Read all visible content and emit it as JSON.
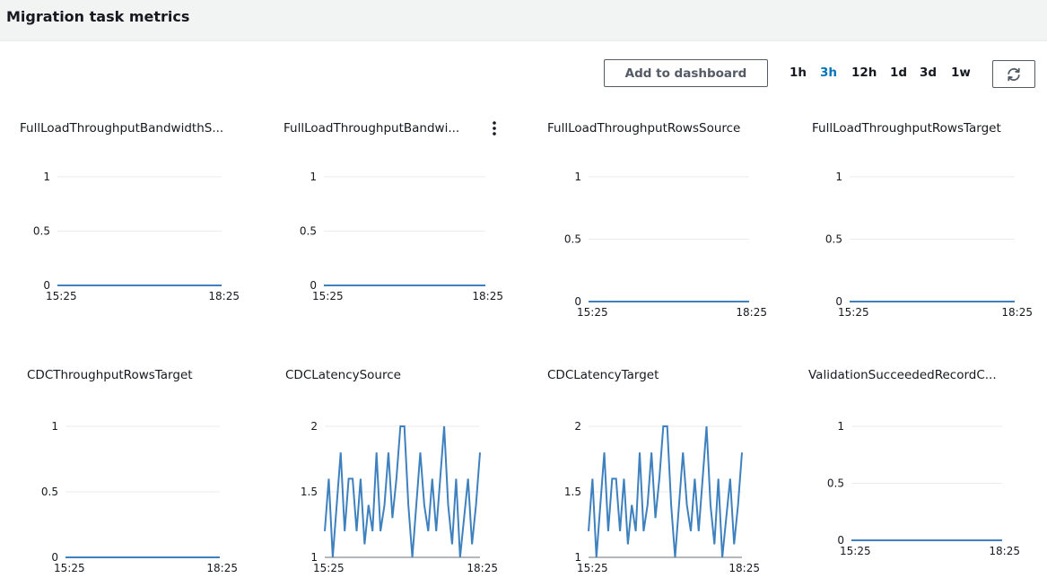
{
  "header": {
    "title": "Migration task metrics"
  },
  "toolbar": {
    "add_to_dashboard_label": "Add to dashboard",
    "time_ranges": [
      "1h",
      "3h",
      "12h",
      "1d",
      "3d",
      "1w"
    ],
    "selected_time_range": "3h",
    "refresh_icon": "refresh-icon",
    "widget_menu_icon": "more-vertical-icon"
  },
  "colors": {
    "line": "#3e81be",
    "selected_range": "#0073bb",
    "gridline": "#e9ebed",
    "axis": "#687078"
  },
  "chart_data": [
    {
      "type": "line",
      "title": "FullLoadThroughputBandwidthS...",
      "x": [
        "15:25",
        "18:25"
      ],
      "yticks": [
        "0",
        "0.5",
        "1"
      ],
      "ylim": [
        0,
        1
      ],
      "series": [
        {
          "values": [
            0,
            0
          ]
        }
      ]
    },
    {
      "type": "line",
      "title": "FullLoadThroughputBandwi...",
      "x": [
        "15:25",
        "18:25"
      ],
      "yticks": [
        "0",
        "0.5",
        "1"
      ],
      "ylim": [
        0,
        1
      ],
      "series": [
        {
          "values": [
            0,
            0
          ]
        }
      ]
    },
    {
      "type": "line",
      "title": "FullLoadThroughputRowsSource",
      "x": [
        "15:25",
        "18:25"
      ],
      "yticks": [
        "0",
        "0.5",
        "1"
      ],
      "ylim": [
        0,
        1
      ],
      "series": [
        {
          "values": [
            0,
            0
          ]
        }
      ]
    },
    {
      "type": "line",
      "title": "FullLoadThroughputRowsTarget",
      "x": [
        "15:25",
        "18:25"
      ],
      "yticks": [
        "0",
        "0.5",
        "1"
      ],
      "ylim": [
        0,
        1
      ],
      "series": [
        {
          "values": [
            0,
            0
          ]
        }
      ]
    },
    {
      "type": "line",
      "title": "CDCThroughputRowsTarget",
      "x": [
        "15:25",
        "18:25"
      ],
      "yticks": [
        "0",
        "0.5",
        "1"
      ],
      "ylim": [
        0,
        1
      ],
      "series": [
        {
          "values": [
            0,
            0
          ]
        }
      ]
    },
    {
      "type": "line",
      "title": "CDCLatencySource",
      "x": [
        "15:25",
        "18:25"
      ],
      "yticks": [
        "1",
        "1.5",
        "2"
      ],
      "ylim": [
        1,
        2
      ],
      "series": [
        {
          "values": [
            1.2,
            1.6,
            1,
            1.4,
            1.8,
            1.2,
            1.6,
            1.6,
            1.2,
            1.6,
            1.1,
            1.4,
            1.2,
            1.8,
            1.2,
            1.4,
            1.8,
            1.3,
            1.6,
            2,
            2,
            1.4,
            1,
            1.4,
            1.8,
            1.4,
            1.2,
            1.6,
            1.2,
            1.6,
            2,
            1.4,
            1.1,
            1.6,
            1,
            1.3,
            1.6,
            1.1,
            1.4,
            1.8
          ]
        }
      ]
    },
    {
      "type": "line",
      "title": "CDCLatencyTarget",
      "x": [
        "15:25",
        "18:25"
      ],
      "yticks": [
        "1",
        "1.5",
        "2"
      ],
      "ylim": [
        1,
        2
      ],
      "series": [
        {
          "values": [
            1.2,
            1.6,
            1,
            1.4,
            1.8,
            1.2,
            1.6,
            1.6,
            1.2,
            1.6,
            1.1,
            1.4,
            1.2,
            1.8,
            1.2,
            1.4,
            1.8,
            1.3,
            1.6,
            2,
            2,
            1.4,
            1,
            1.4,
            1.8,
            1.4,
            1.2,
            1.6,
            1.2,
            1.6,
            2,
            1.4,
            1.1,
            1.6,
            1,
            1.3,
            1.6,
            1.1,
            1.4,
            1.8
          ]
        }
      ]
    },
    {
      "type": "line",
      "title": "ValidationSucceededRecordC...",
      "x": [
        "15:25",
        "18:25"
      ],
      "yticks": [
        "0",
        "0.5",
        "1"
      ],
      "ylim": [
        0,
        1
      ],
      "series": [
        {
          "values": [
            0,
            0
          ]
        }
      ]
    }
  ]
}
